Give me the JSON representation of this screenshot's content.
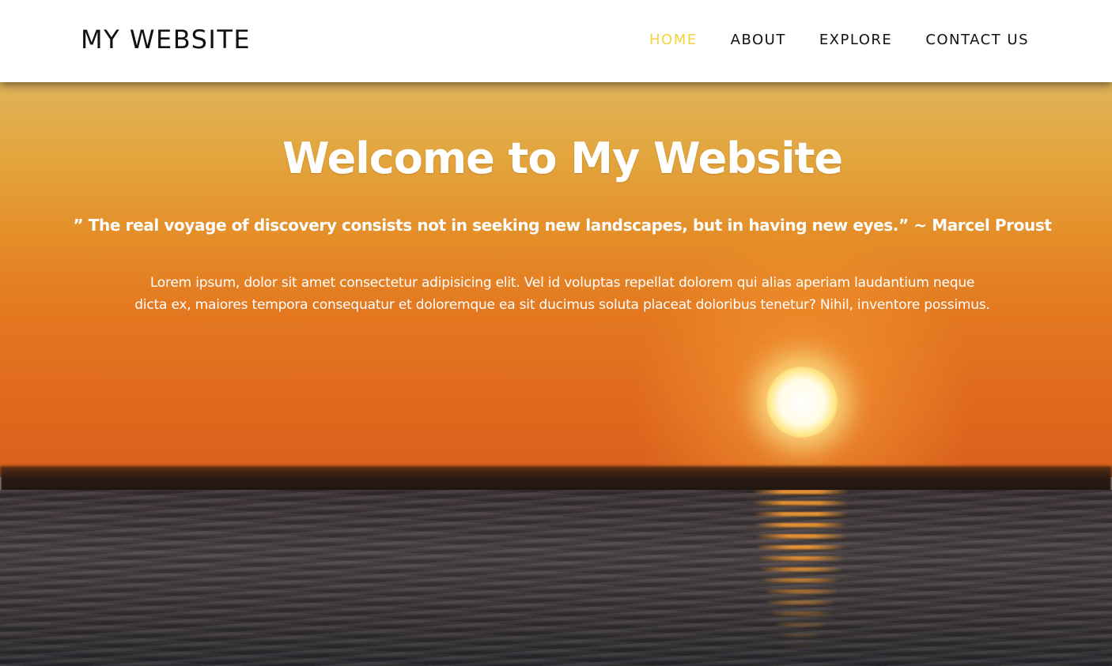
{
  "header": {
    "brand": "MY WEBSITE",
    "nav": [
      {
        "label": "HOME",
        "active": true
      },
      {
        "label": "ABOUT",
        "active": false
      },
      {
        "label": "EXPLORE",
        "active": false
      },
      {
        "label": "CONTACT US",
        "active": false
      }
    ]
  },
  "hero": {
    "title": "Welcome to My Website",
    "quote": "” The real voyage of discovery consists not in seeking new landscapes, but in having new eyes.” ~ Marcel Proust",
    "paragraph": "Lorem ipsum, dolor sit amet consectetur adipisicing elit. Vel id voluptas repellat dolorem qui alias aperiam laudantium neque dicta ex, maiores tempora consequatur et doloremque ea sit ducimus soluta placeat doloribus tenetur? Nihil, inventore possimus.",
    "background_image": "sunset-over-sea"
  },
  "colors": {
    "nav_active": "#f7d23a",
    "nav_text": "#111111",
    "header_bg": "#ffffff",
    "hero_text": "#ffffff"
  }
}
